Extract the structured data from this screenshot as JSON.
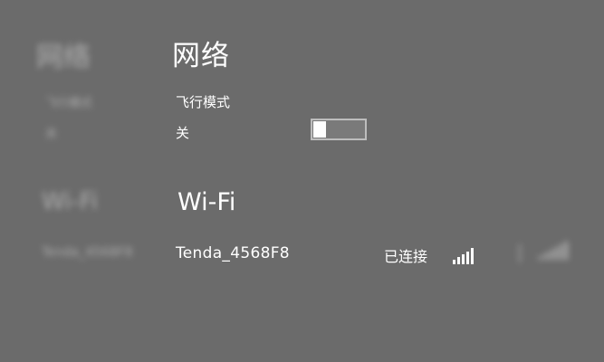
{
  "background_ghost": {
    "title": "网络",
    "airplane_label": "飞行模式",
    "airplane_state": "关",
    "wifi_title": "Wi-Fi",
    "network_name": "Tenda_4568F8"
  },
  "network_panel": {
    "title": "网络",
    "airplane_mode": {
      "label": "飞行模式",
      "state_label": "关",
      "is_on": false
    },
    "wifi_section": {
      "title": "Wi-Fi",
      "networks": [
        {
          "name": "Tenda_4568F8",
          "status": "已连接",
          "signal_icon": "signal-strength-icon",
          "signal_bars": 5
        }
      ]
    }
  },
  "colors": {
    "background": "#6b6b6b",
    "text": "#ffffff",
    "toggle_track": "#7a7a7a",
    "toggle_border": "#bdbdbd"
  }
}
